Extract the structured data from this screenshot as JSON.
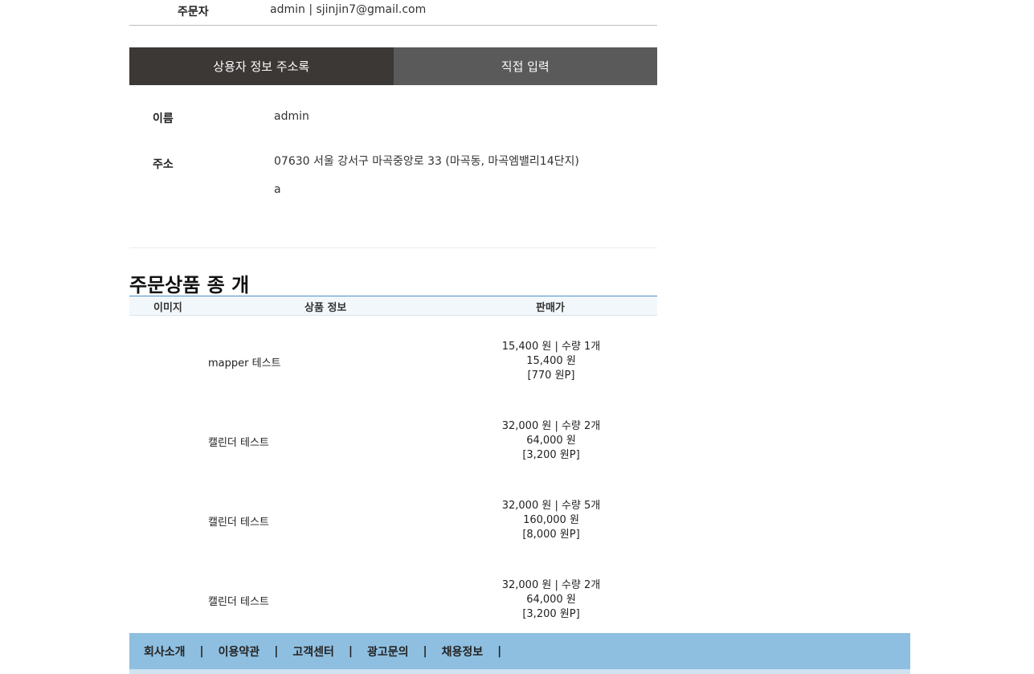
{
  "orderer": {
    "label": "주문자",
    "value": "admin | sjinjin7@gmail.com"
  },
  "tabs": [
    {
      "label": "상용자 정보 주소록",
      "active": true
    },
    {
      "label": "직접 입력",
      "active": false
    }
  ],
  "receiver": {
    "name_label": "이름",
    "name_value": "admin",
    "address_label": "주소",
    "address_line1": "07630 서울 강서구 마곡중앙로 33 (마곡동, 마곡엠밸리14단지)",
    "address_line2": "a"
  },
  "order_section": {
    "title": "주문상품 종 개"
  },
  "table": {
    "headers": {
      "image": "이미지",
      "info": "상품 정보",
      "price": "판매가"
    },
    "rows": [
      {
        "name": "mapper 테스트",
        "unit_qty": "15,400 원 | 수량 1개",
        "total": "15,400 원",
        "points": "[770 원P]"
      },
      {
        "name": "캘린더 테스트",
        "unit_qty": "32,000 원 | 수량 2개",
        "total": "64,000 원",
        "points": "[3,200 원P]"
      },
      {
        "name": "캘린더 테스트",
        "unit_qty": "32,000 원 | 수량 5개",
        "total": "160,000 원",
        "points": "[8,000 원P]"
      },
      {
        "name": "캘린더 테스트",
        "unit_qty": "32,000 원 | 수량 2개",
        "total": "64,000 원",
        "points": "[3,200 원P]"
      }
    ]
  },
  "footer": {
    "links": [
      "회사소개",
      "이용약관",
      "고객센터",
      "광고문의",
      "채용정보"
    ],
    "separator": "|"
  },
  "colors": {
    "tab_active": "#3c3836",
    "tab_inactive": "#5a5a5a",
    "footer_bg": "#8fbfe0",
    "table_head_border": "#4a90c8"
  }
}
